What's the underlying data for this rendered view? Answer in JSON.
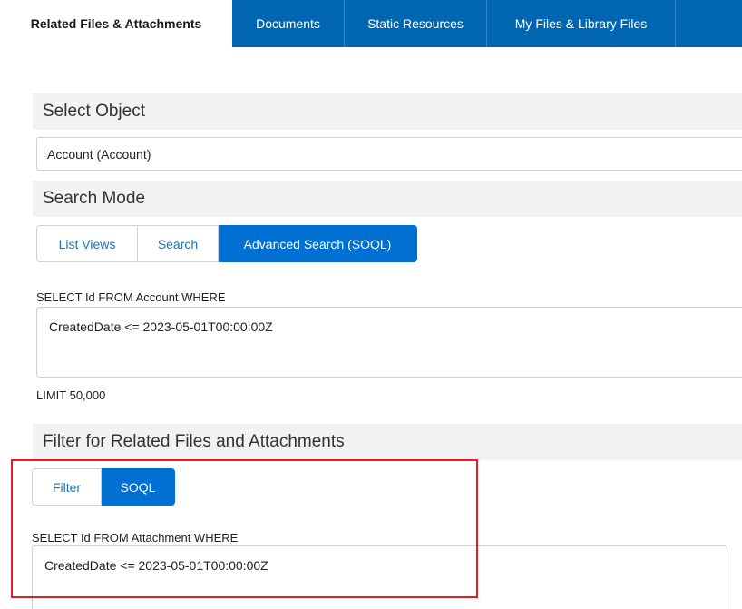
{
  "tabs": [
    {
      "label": "Related Files & Attachments",
      "active": true
    },
    {
      "label": "Documents",
      "active": false
    },
    {
      "label": "Static Resources",
      "active": false
    },
    {
      "label": "My Files & Library Files",
      "active": false
    }
  ],
  "select_object": {
    "header": "Select Object",
    "selected_value": "Account (Account)"
  },
  "search_mode": {
    "header": "Search Mode",
    "options": [
      "List Views",
      "Search",
      "Advanced Search (SOQL)"
    ],
    "selected": "Advanced Search (SOQL)"
  },
  "account_query": {
    "prefix": "SELECT Id FROM Account WHERE",
    "condition": "CreatedDate <= 2023-05-01T00:00:00Z",
    "limit": "LIMIT 50,000"
  },
  "filter_section": {
    "header": "Filter for Related Files and Attachments",
    "options": [
      "Filter",
      "SOQL"
    ],
    "selected": "SOQL"
  },
  "attachment_query": {
    "prefix": "SELECT Id FROM Attachment WHERE",
    "condition": "CreatedDate <= 2023-05-01T00:00:00Z"
  },
  "colors": {
    "tab_bar": "#0066b2",
    "selected_button": "#0070d2",
    "highlight": "#e02020",
    "section_header_bg": "#f2f2f2"
  }
}
